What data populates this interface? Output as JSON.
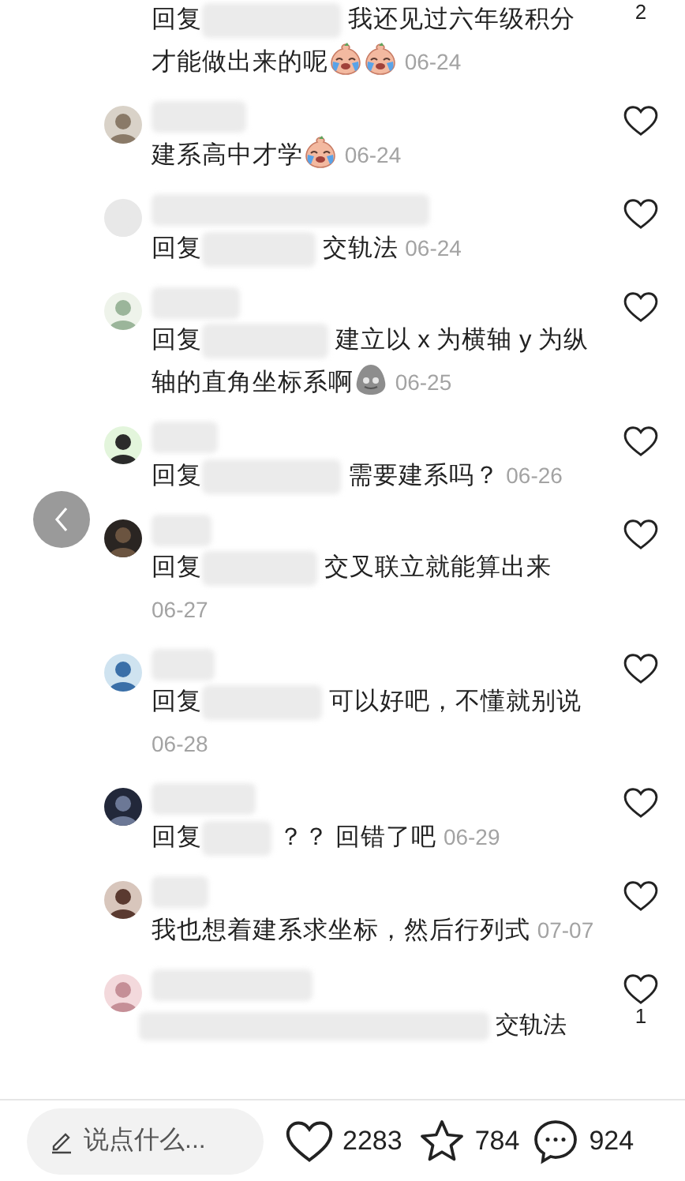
{
  "comments": [
    {
      "kind": "top_cut",
      "reply_label": "回复",
      "text_lines": [
        "我还见过六年级积分",
        "才能做出来的呢"
      ],
      "stickers": [
        {
          "kind": "crying_laugh"
        },
        {
          "kind": "crying_laugh"
        }
      ],
      "date": "06-24",
      "likes": "2"
    },
    {
      "kind": "full",
      "text": "建系高中才学",
      "stickers": [
        {
          "kind": "crying_laugh"
        }
      ],
      "date": "06-24"
    },
    {
      "kind": "full",
      "reply_label": "回复",
      "text": "交轨法",
      "date": "06-24"
    },
    {
      "kind": "full",
      "reply_label": "回复",
      "text_lines": [
        "建立以 x 为横轴 y 为纵",
        "轴的直角坐标系啊"
      ],
      "stickers": [
        {
          "kind": "blob_face"
        }
      ],
      "date": "06-25"
    },
    {
      "kind": "full",
      "reply_label": "回复",
      "text": "需要建系吗？",
      "date": "06-26"
    },
    {
      "kind": "full",
      "reply_label": "回复",
      "text": "交叉联立就能算出来",
      "date": "06-27"
    },
    {
      "kind": "full",
      "reply_label": "回复",
      "text": "可以好吧，不懂就别说",
      "date": "06-28"
    },
    {
      "kind": "full",
      "reply_label": "回复",
      "text": "？？ 回错了吧",
      "date": "06-29"
    },
    {
      "kind": "full",
      "text": "我也想着建系求坐标，然后行列式",
      "date": "07-07"
    },
    {
      "kind": "bottom_cut",
      "text": "交轨法",
      "likes": "1"
    }
  ],
  "bottom_bar": {
    "placeholder": "说点什么...",
    "likes": "2283",
    "favorites": "784",
    "comments": "924"
  }
}
